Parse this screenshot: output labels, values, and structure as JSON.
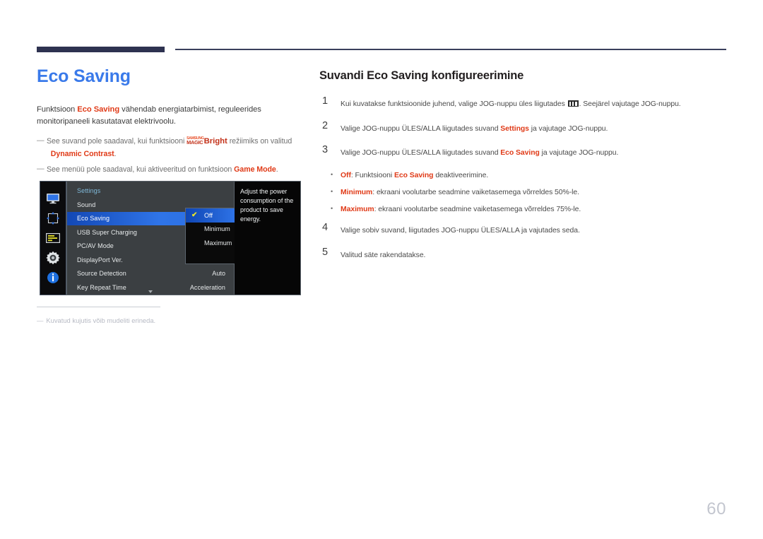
{
  "page": {
    "number": "60"
  },
  "left": {
    "title": "Eco Saving",
    "intro_pre": "Funktsioon ",
    "intro_bold": "Eco Saving",
    "intro_post": " vähendab energiatarbimist, reguleerides monitoripaneeli kasutatavat elektrivoolu.",
    "note1_pre": "See suvand pole saadaval, kui funktsiooni ",
    "note1_logo_top": "SAMSUNG",
    "note1_logo_bottom": "MAGIC",
    "note1_logo_word": "Bright",
    "note1_mid": " režiimiks on valitud ",
    "note1_bold": "Dynamic Contrast",
    "note1_end": ".",
    "note2_pre": "See menüü pole saadaval, kui aktiveeritud on funktsioon ",
    "note2_bold": "Game Mode",
    "note2_end": ".",
    "dash": "―",
    "footnote_dash": "―",
    "footnote": "Kuvatud kujutis võib mudeliti erineda."
  },
  "osd": {
    "icons": [
      {
        "name": "display-icon",
        "label": "Picture"
      },
      {
        "name": "screen-adjust-icon",
        "label": "Screen Adjustment"
      },
      {
        "name": "onscreen-display-icon",
        "label": "OnScreen Display"
      },
      {
        "name": "system-gear-icon",
        "label": "System"
      },
      {
        "name": "information-icon",
        "label": "Information"
      }
    ],
    "menu_title": "Settings",
    "rows": [
      {
        "label": "Sound",
        "value": "",
        "selected": false
      },
      {
        "label": "Eco Saving",
        "value": "",
        "selected": true
      },
      {
        "label": "USB Super Charging",
        "value": "",
        "selected": false
      },
      {
        "label": "PC/AV Mode",
        "value": "",
        "selected": false
      },
      {
        "label": "DisplayPort Ver.",
        "value": "",
        "selected": false
      },
      {
        "label": "Source Detection",
        "value": "Auto",
        "selected": false
      },
      {
        "label": "Key Repeat Time",
        "value": "Acceleration",
        "selected": false
      }
    ],
    "submenu": [
      {
        "label": "Off",
        "selected": true,
        "check": "✔"
      },
      {
        "label": "Minimum",
        "selected": false,
        "check": ""
      },
      {
        "label": "Maximum",
        "selected": false,
        "check": ""
      }
    ],
    "help_text": "Adjust the power consumption of the product to save energy."
  },
  "right": {
    "title": "Suvandi Eco Saving konfigureerimine",
    "steps": [
      {
        "num": "1",
        "pre": "Kui kuvatakse funktsioonide juhend, valige JOG-nuppu üles liigutades ",
        "glyph": "menu-keypad-icon",
        "post": ". Seejärel vajutage JOG-nuppu."
      },
      {
        "num": "2",
        "pre": "Valige JOG-nuppu ÜLES/ALLA liigutades suvand ",
        "bold": "Settings",
        "post": " ja vajutage JOG-nuppu."
      },
      {
        "num": "3",
        "pre": "Valige JOG-nuppu ÜLES/ALLA liigutades suvand ",
        "bold": "Eco Saving",
        "post": " ja vajutage JOG-nuppu."
      }
    ],
    "bullets": [
      {
        "dot": "•",
        "bold": "Off",
        "mid": ": Funktsiooni ",
        "bold2": "Eco Saving",
        "post": " deaktiveerimine."
      },
      {
        "dot": "•",
        "bold": "Minimum",
        "mid": ": ekraani voolutarbe seadmine vaiketasemega võrreldes 50%-le.",
        "bold2": "",
        "post": ""
      },
      {
        "dot": "•",
        "bold": "Maximum",
        "mid": ": ekraani voolutarbe seadmine vaiketasemega võrreldes 75%-le.",
        "bold2": "",
        "post": ""
      }
    ],
    "steps_tail": [
      {
        "num": "4",
        "pre": "Valige sobiv suvand, liigutades JOG-nuppu ÜLES/ALLA ja vajutades seda.",
        "bold": "",
        "post": ""
      },
      {
        "num": "5",
        "pre": "Valitud säte rakendatakse.",
        "bold": "",
        "post": ""
      }
    ]
  },
  "colors": {
    "accent_blue": "#3a7aea",
    "accent_red": "#e03a17",
    "header_navy": "#2e3250",
    "osd_highlight": "#2f74e8"
  }
}
